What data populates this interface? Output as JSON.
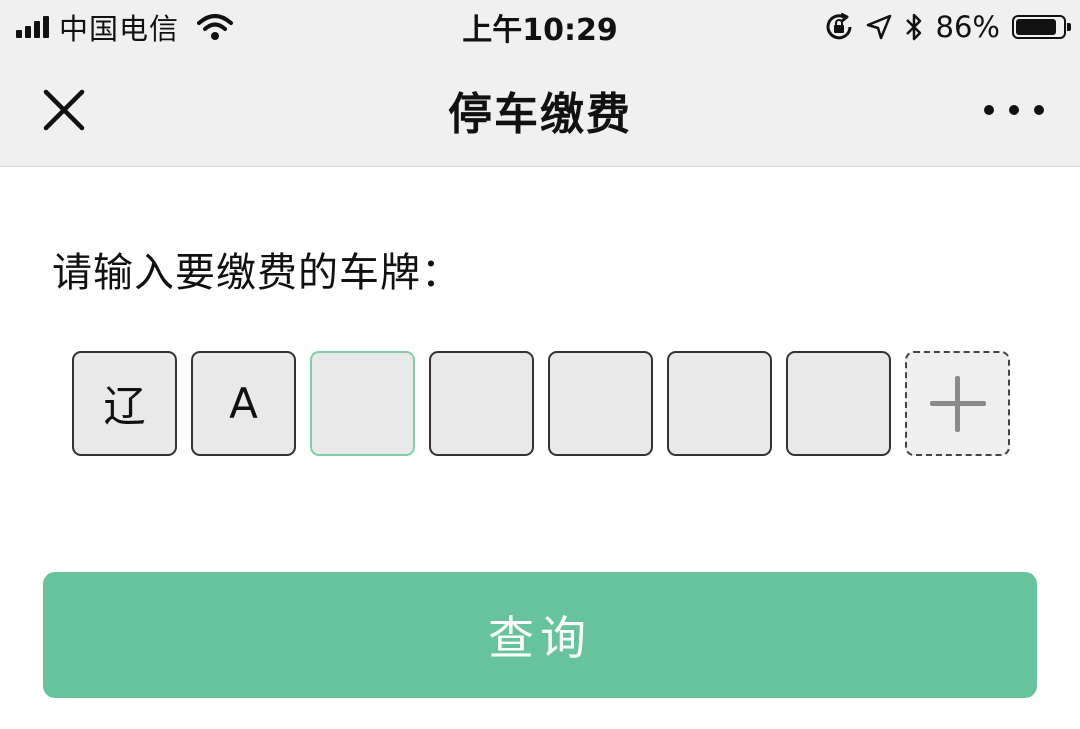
{
  "status_bar": {
    "carrier": "中国电信",
    "time": "上午10:29",
    "battery_percent": "86%",
    "battery_level": 0.86,
    "icons": [
      "signal-icon",
      "wifi-icon",
      "orientation-lock-icon",
      "location-icon",
      "bluetooth-icon",
      "battery-icon"
    ]
  },
  "nav": {
    "title": "停车缴费",
    "close_icon": "close-icon",
    "more_icon": "more-icon"
  },
  "form": {
    "prompt": "请输入要缴费的车牌：",
    "plate_chars": [
      "辽",
      "A",
      "",
      "",
      "",
      "",
      ""
    ],
    "active_index": 2,
    "add_slot_icon": "plus-icon"
  },
  "query_button": {
    "label": "查询"
  },
  "colors": {
    "accent": "#67c39c",
    "active_border": "#7fcfa9",
    "bar_background": "#f0f0f0"
  }
}
